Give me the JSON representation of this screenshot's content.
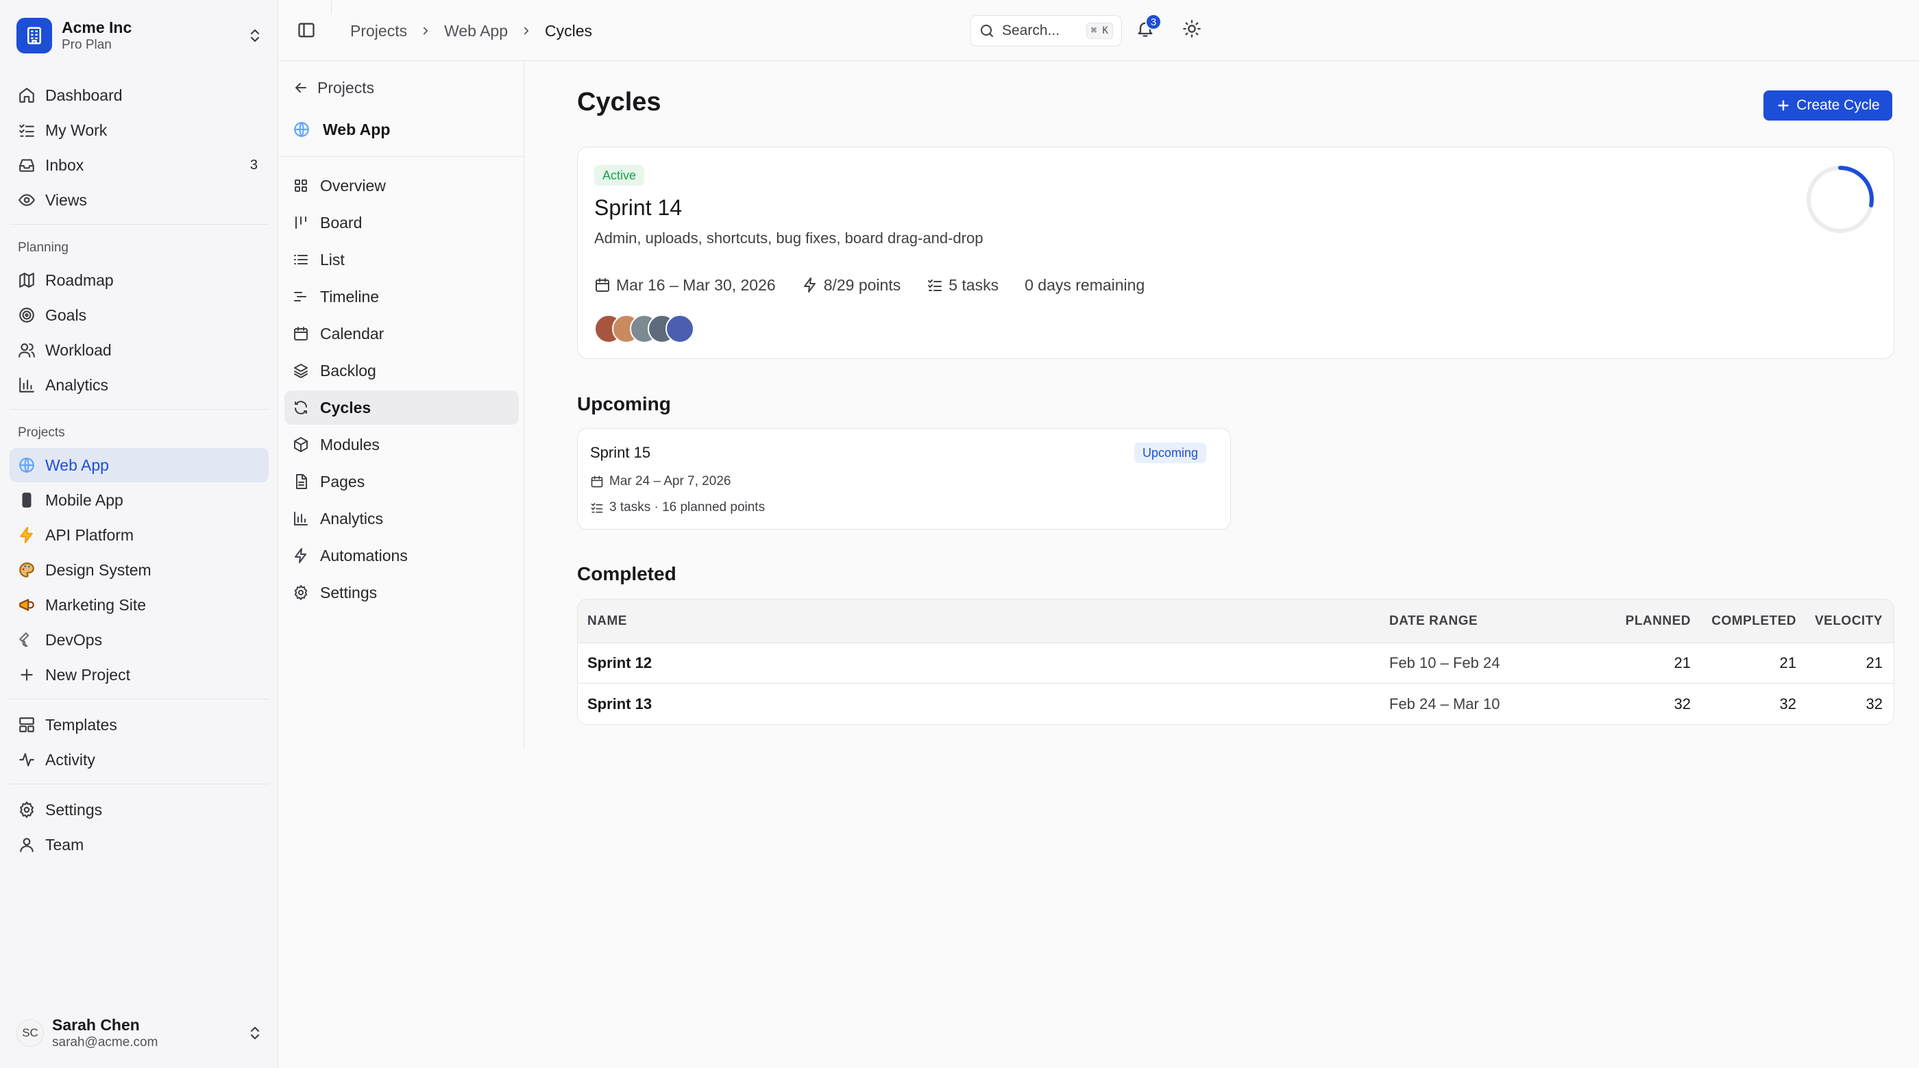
{
  "org": {
    "name": "Acme Inc",
    "plan": "Pro Plan"
  },
  "nav_main": [
    {
      "label": "Dashboard",
      "icon": "home-icon"
    },
    {
      "label": "My Work",
      "icon": "list-checks-icon"
    },
    {
      "label": "Inbox",
      "icon": "inbox-icon",
      "count": "3"
    },
    {
      "label": "Views",
      "icon": "eye-icon"
    }
  ],
  "planning": {
    "label": "Planning",
    "items": [
      {
        "label": "Roadmap",
        "icon": "map-icon"
      },
      {
        "label": "Goals",
        "icon": "target-icon"
      },
      {
        "label": "Workload",
        "icon": "users-icon"
      },
      {
        "label": "Analytics",
        "icon": "bar-chart-icon"
      }
    ]
  },
  "projects": {
    "label": "Projects",
    "items": [
      {
        "label": "Web App",
        "icon": "globe-icon",
        "active": true
      },
      {
        "label": "Mobile App",
        "icon": "phone-icon"
      },
      {
        "label": "API Platform",
        "icon": "lightning-icon"
      },
      {
        "label": "Design System",
        "icon": "palette-icon"
      },
      {
        "label": "Marketing Site",
        "icon": "megaphone-icon"
      },
      {
        "label": "DevOps",
        "icon": "wrench-icon"
      },
      {
        "label": "New Project",
        "icon": "plus-icon"
      }
    ]
  },
  "nav_bottom": [
    {
      "label": "Templates",
      "icon": "layout-icon"
    },
    {
      "label": "Activity",
      "icon": "activity-icon"
    }
  ],
  "nav_footer": [
    {
      "label": "Settings",
      "icon": "gear-icon"
    },
    {
      "label": "Team",
      "icon": "user-icon"
    }
  ],
  "user": {
    "initials": "SC",
    "name": "Sarah Chen",
    "email": "sarah@acme.com"
  },
  "breadcrumb": [
    "Projects",
    "Web App",
    "Cycles"
  ],
  "search": {
    "placeholder": "Search...",
    "shortcut": "⌘ K"
  },
  "notifications": {
    "count": "3"
  },
  "project_nav": {
    "back_label": "Projects",
    "project_name": "Web App",
    "items": [
      {
        "label": "Overview",
        "icon": "grid-icon"
      },
      {
        "label": "Board",
        "icon": "kanban-icon"
      },
      {
        "label": "List",
        "icon": "list-icon"
      },
      {
        "label": "Timeline",
        "icon": "timeline-icon"
      },
      {
        "label": "Calendar",
        "icon": "calendar-icon"
      },
      {
        "label": "Backlog",
        "icon": "layers-icon"
      },
      {
        "label": "Cycles",
        "icon": "refresh-icon",
        "active": true
      },
      {
        "label": "Modules",
        "icon": "package-icon"
      },
      {
        "label": "Pages",
        "icon": "file-icon"
      },
      {
        "label": "Analytics",
        "icon": "bar-chart-icon"
      },
      {
        "label": "Automations",
        "icon": "lightning-icon"
      },
      {
        "label": "Settings",
        "icon": "gear-icon"
      }
    ]
  },
  "page": {
    "title": "Cycles",
    "create_label": "Create Cycle"
  },
  "active_cycle": {
    "status": "Active",
    "name": "Sprint 14",
    "description": "Admin, uploads, shortcuts, bug fixes, board drag-and-drop",
    "date_range": "Mar 16 – Mar 30, 2026",
    "points": "8/29 points",
    "tasks": "5 tasks",
    "remaining": "0 days remaining",
    "progress": 0.28,
    "avatar_colors": [
      "#a8553f",
      "#c98a5e",
      "#7d8a93",
      "#5d6b7a",
      "#4a5fb0"
    ],
    "accent": "#1d4ed8"
  },
  "upcoming": {
    "heading": "Upcoming",
    "name": "Sprint 15",
    "status": "Upcoming",
    "date_range": "Mar 24 – Apr 7, 2026",
    "summary": "3 tasks · 16 planned points"
  },
  "completed": {
    "heading": "Completed",
    "columns": [
      "NAME",
      "DATE RANGE",
      "PLANNED",
      "COMPLETED",
      "VELOCITY"
    ],
    "rows": [
      {
        "name": "Sprint 12",
        "range": "Feb 10 – Feb 24",
        "planned": "21",
        "completed": "21",
        "velocity": "21"
      },
      {
        "name": "Sprint 13",
        "range": "Feb 24 – Mar 10",
        "planned": "32",
        "completed": "32",
        "velocity": "32"
      }
    ]
  }
}
